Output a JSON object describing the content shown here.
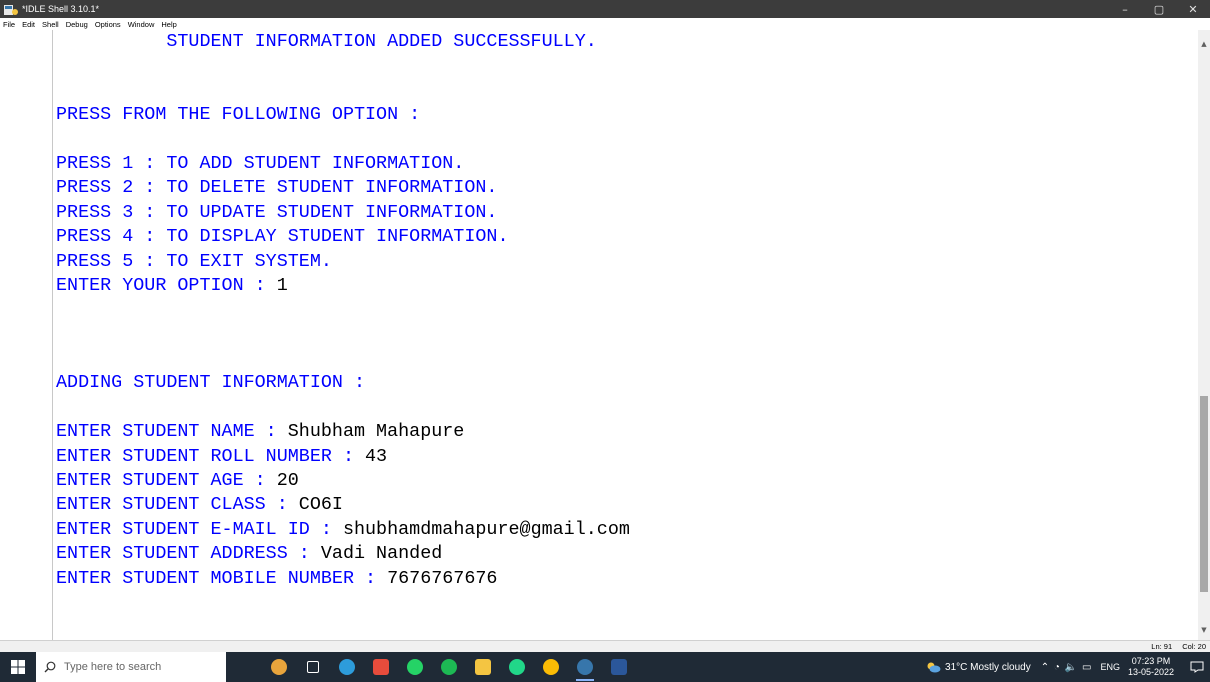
{
  "window": {
    "title": "*IDLE Shell 3.10.1*",
    "controls": {
      "minimize": "–",
      "maximize": "▢",
      "close": "✕"
    }
  },
  "menu": [
    "File",
    "Edit",
    "Shell",
    "Debug",
    "Options",
    "Window",
    "Help"
  ],
  "shell_lines": [
    {
      "text": "          STUDENT INFORMATION ADDED SUCCESSFULLY.",
      "input": ""
    },
    {
      "text": "",
      "input": ""
    },
    {
      "text": "",
      "input": ""
    },
    {
      "text": "PRESS FROM THE FOLLOWING OPTION :",
      "input": ""
    },
    {
      "text": "",
      "input": ""
    },
    {
      "text": "PRESS 1 : TO ADD STUDENT INFORMATION.",
      "input": ""
    },
    {
      "text": "PRESS 2 : TO DELETE STUDENT INFORMATION.",
      "input": ""
    },
    {
      "text": "PRESS 3 : TO UPDATE STUDENT INFORMATION.",
      "input": ""
    },
    {
      "text": "PRESS 4 : TO DISPLAY STUDENT INFORMATION.",
      "input": ""
    },
    {
      "text": "PRESS 5 : TO EXIT SYSTEM.",
      "input": ""
    },
    {
      "text": "ENTER YOUR OPTION : ",
      "input": "1"
    },
    {
      "text": "",
      "input": ""
    },
    {
      "text": "",
      "input": ""
    },
    {
      "text": "",
      "input": ""
    },
    {
      "text": "ADDING STUDENT INFORMATION :",
      "input": ""
    },
    {
      "text": "",
      "input": ""
    },
    {
      "text": "ENTER STUDENT NAME : ",
      "input": "Shubham Mahapure"
    },
    {
      "text": "ENTER STUDENT ROLL NUMBER : ",
      "input": "43"
    },
    {
      "text": "ENTER STUDENT AGE : ",
      "input": "20"
    },
    {
      "text": "ENTER STUDENT CLASS : ",
      "input": "CO6I"
    },
    {
      "text": "ENTER STUDENT E-MAIL ID : ",
      "input": "shubhamdmahapure@gmail.com"
    },
    {
      "text": "ENTER STUDENT ADDRESS : ",
      "input": "Vadi Nanded"
    },
    {
      "text": "ENTER STUDENT MOBILE NUMBER : ",
      "input": "7676767676"
    }
  ],
  "status": {
    "line": "Ln: 91",
    "col": "Col: 20"
  },
  "taskbar": {
    "search_placeholder": "Type here to search",
    "weather": "31°C  Mostly cloudy",
    "lang": "ENG",
    "time": "07:23 PM",
    "date": "13-05-2022",
    "apps": [
      {
        "name": "widget-icon",
        "color": "#e8a43c"
      },
      {
        "name": "task-view-icon",
        "color": "#ffffff"
      },
      {
        "name": "edge-icon",
        "color": "#2d9cdb"
      },
      {
        "name": "office-icon",
        "color": "#e74c3c"
      },
      {
        "name": "whatsapp-icon",
        "color": "#25d366"
      },
      {
        "name": "spotify-icon",
        "color": "#1db954"
      },
      {
        "name": "file-explorer-icon",
        "color": "#f4c542"
      },
      {
        "name": "pycharm-icon",
        "color": "#21d789"
      },
      {
        "name": "chrome-icon",
        "color": "#fbbc05"
      },
      {
        "name": "python-idle-icon",
        "color": "#3776ab"
      },
      {
        "name": "word-icon",
        "color": "#2b579a"
      }
    ]
  },
  "colors": {
    "prompt": "#0000ff",
    "user_input": "#000000",
    "titlebar": "#3c3c3c",
    "taskbar": "#1f2a36"
  }
}
